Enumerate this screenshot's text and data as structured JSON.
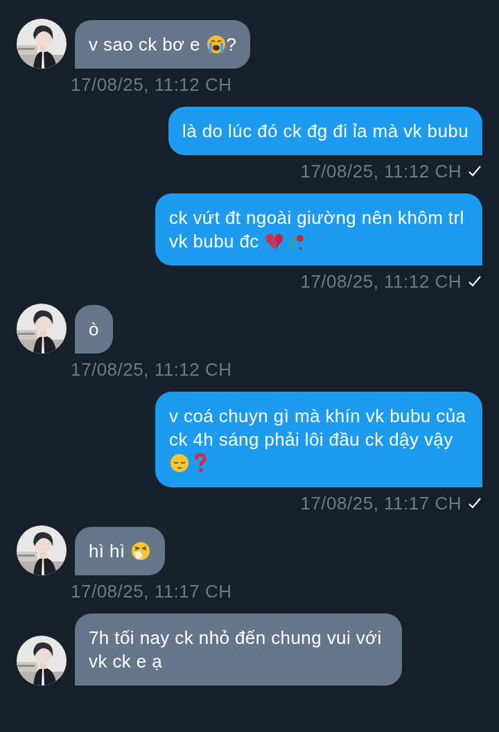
{
  "messages": [
    {
      "kind": "received",
      "parts": [
        {
          "kind": "text",
          "text": "v sao ck bơ e "
        },
        {
          "kind": "crying"
        },
        {
          "kind": "text",
          "text": "?"
        }
      ],
      "time": "17/08/25, 11:12 CH"
    },
    {
      "kind": "sent",
      "parts": [
        {
          "kind": "text",
          "text": "là do lúc đó ck đg đi ỉa mà vk bubu"
        }
      ],
      "time": "17/08/25, 11:12 CH",
      "seen": true
    },
    {
      "kind": "sent",
      "parts": [
        {
          "kind": "text",
          "text": "ck vứt đt ngoài giường nên khôm trl vk bubu đc "
        },
        {
          "kind": "broken-heart"
        },
        {
          "kind": "wilted-rose"
        }
      ],
      "time": "17/08/25, 11:12 CH",
      "seen": true
    },
    {
      "kind": "received",
      "parts": [
        {
          "kind": "text",
          "text": "ò"
        }
      ],
      "time": "17/08/25, 11:12 CH"
    },
    {
      "kind": "sent",
      "parts": [
        {
          "kind": "text",
          "text": "v coá chuyn gì mà khín vk bubu của ck 4h sáng phải lôi đầu ck dậy vậy "
        },
        {
          "kind": "pensive"
        },
        {
          "kind": "question"
        }
      ],
      "time": "17/08/25, 11:17 CH",
      "seen": true
    },
    {
      "kind": "received",
      "parts": [
        {
          "kind": "text",
          "text": "hì hì "
        },
        {
          "kind": "sneezing"
        }
      ],
      "time": "17/08/25, 11:17 CH"
    },
    {
      "kind": "received",
      "parts": [
        {
          "kind": "text",
          "text": "7h tối nay ck nhỏ đến chung vui với vk ck e ạ"
        }
      ]
    }
  ]
}
